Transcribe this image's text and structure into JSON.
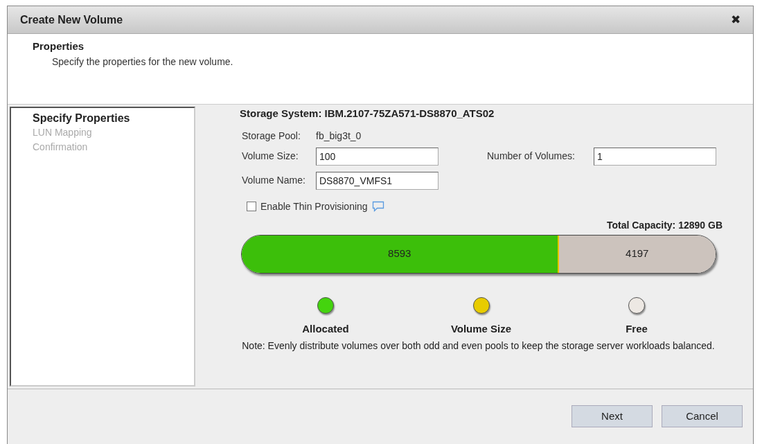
{
  "window": {
    "title": "Create New Volume",
    "close": "✖"
  },
  "header": {
    "title": "Properties",
    "subtitle": "Specify the properties for the new volume."
  },
  "steps": [
    {
      "label": "Specify Properties",
      "selected": true
    },
    {
      "label": "LUN Mapping",
      "selected": false
    },
    {
      "label": "Confirmation",
      "selected": false
    }
  ],
  "storage_system": "Storage System: IBM.2107-75ZA571-DS8870_ATS02",
  "storage_pool": {
    "label": "Storage Pool:",
    "value": "fb_big3t_0"
  },
  "volume_size": {
    "label": "Volume Size:",
    "value": "100"
  },
  "number_of_volumes": {
    "label": "Number of Volumes:",
    "value": "1"
  },
  "volume_name": {
    "label": "Volume Name:",
    "value": "DS8870_VMFS1"
  },
  "thin_provisioning": {
    "label": "Enable Thin Provisioning",
    "checked": false
  },
  "total_capacity": "Total Capacity: 12890 GB",
  "capacity_bar": [
    {
      "label": "8593",
      "level": 0.666,
      "color": "#3cbf0a"
    },
    {
      "level": 0.003,
      "color": "#e8c400"
    },
    {
      "label": "4197",
      "level": 0.331,
      "color": "#ccc3bd"
    }
  ],
  "legend": [
    {
      "label": "Allocated",
      "color": "#44d40e"
    },
    {
      "label": "Volume Size",
      "color": "#e8cc00"
    },
    {
      "label": "Free",
      "color": "#ede8e3"
    }
  ],
  "note": "Note: Evenly distribute volumes over both odd and even pools to keep the storage server workloads balanced.",
  "buttons": [
    "Next",
    "Cancel"
  ]
}
